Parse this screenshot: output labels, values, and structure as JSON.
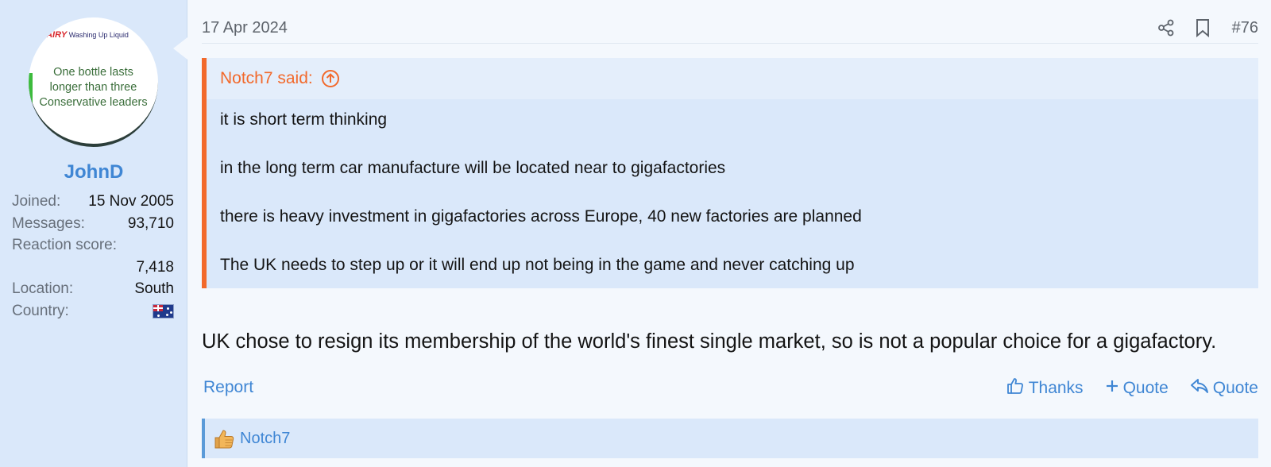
{
  "user": {
    "avatar_brand": "FAIRY",
    "avatar_brand_sub": "Washing Up Liquid",
    "avatar_slogan": [
      "One bottle lasts",
      "longer than three",
      "Conservative leaders"
    ],
    "username": "JohnD",
    "stats": [
      {
        "label": "Joined:",
        "value": "15 Nov 2005"
      },
      {
        "label": "Messages:",
        "value": "93,710"
      },
      {
        "label": "Reaction score:",
        "value": "7,418"
      },
      {
        "label": "Location:",
        "value": "South"
      },
      {
        "label": "Country:",
        "value": ""
      }
    ],
    "country_flag_icon": "australia-flag-icon"
  },
  "post": {
    "date": "17 Apr 2024",
    "number": "#76",
    "quote": {
      "author_label": "Notch7 said:",
      "lines": [
        "it is short term thinking",
        "in the long term car manufacture will be located near to gigafactories",
        "there is heavy investment in gigafactories across Europe, 40 new factories are planned",
        "The UK needs to step up or it will end up not being in the game and never catching up"
      ]
    },
    "text": "UK chose to resign its membership of the world's finest single market, so is not a popular choice for a gigafactory."
  },
  "actions": {
    "report": "Report",
    "thanks": "Thanks",
    "multi_quote": "Quote",
    "reply_quote": "Quote"
  },
  "reactions": {
    "icon": "thumbs-up-emoji",
    "users": "Notch7"
  },
  "colors": {
    "accent": "#3f86d4",
    "quote_accent": "#f2692b",
    "sidebar_bg": "#dae8fa"
  }
}
